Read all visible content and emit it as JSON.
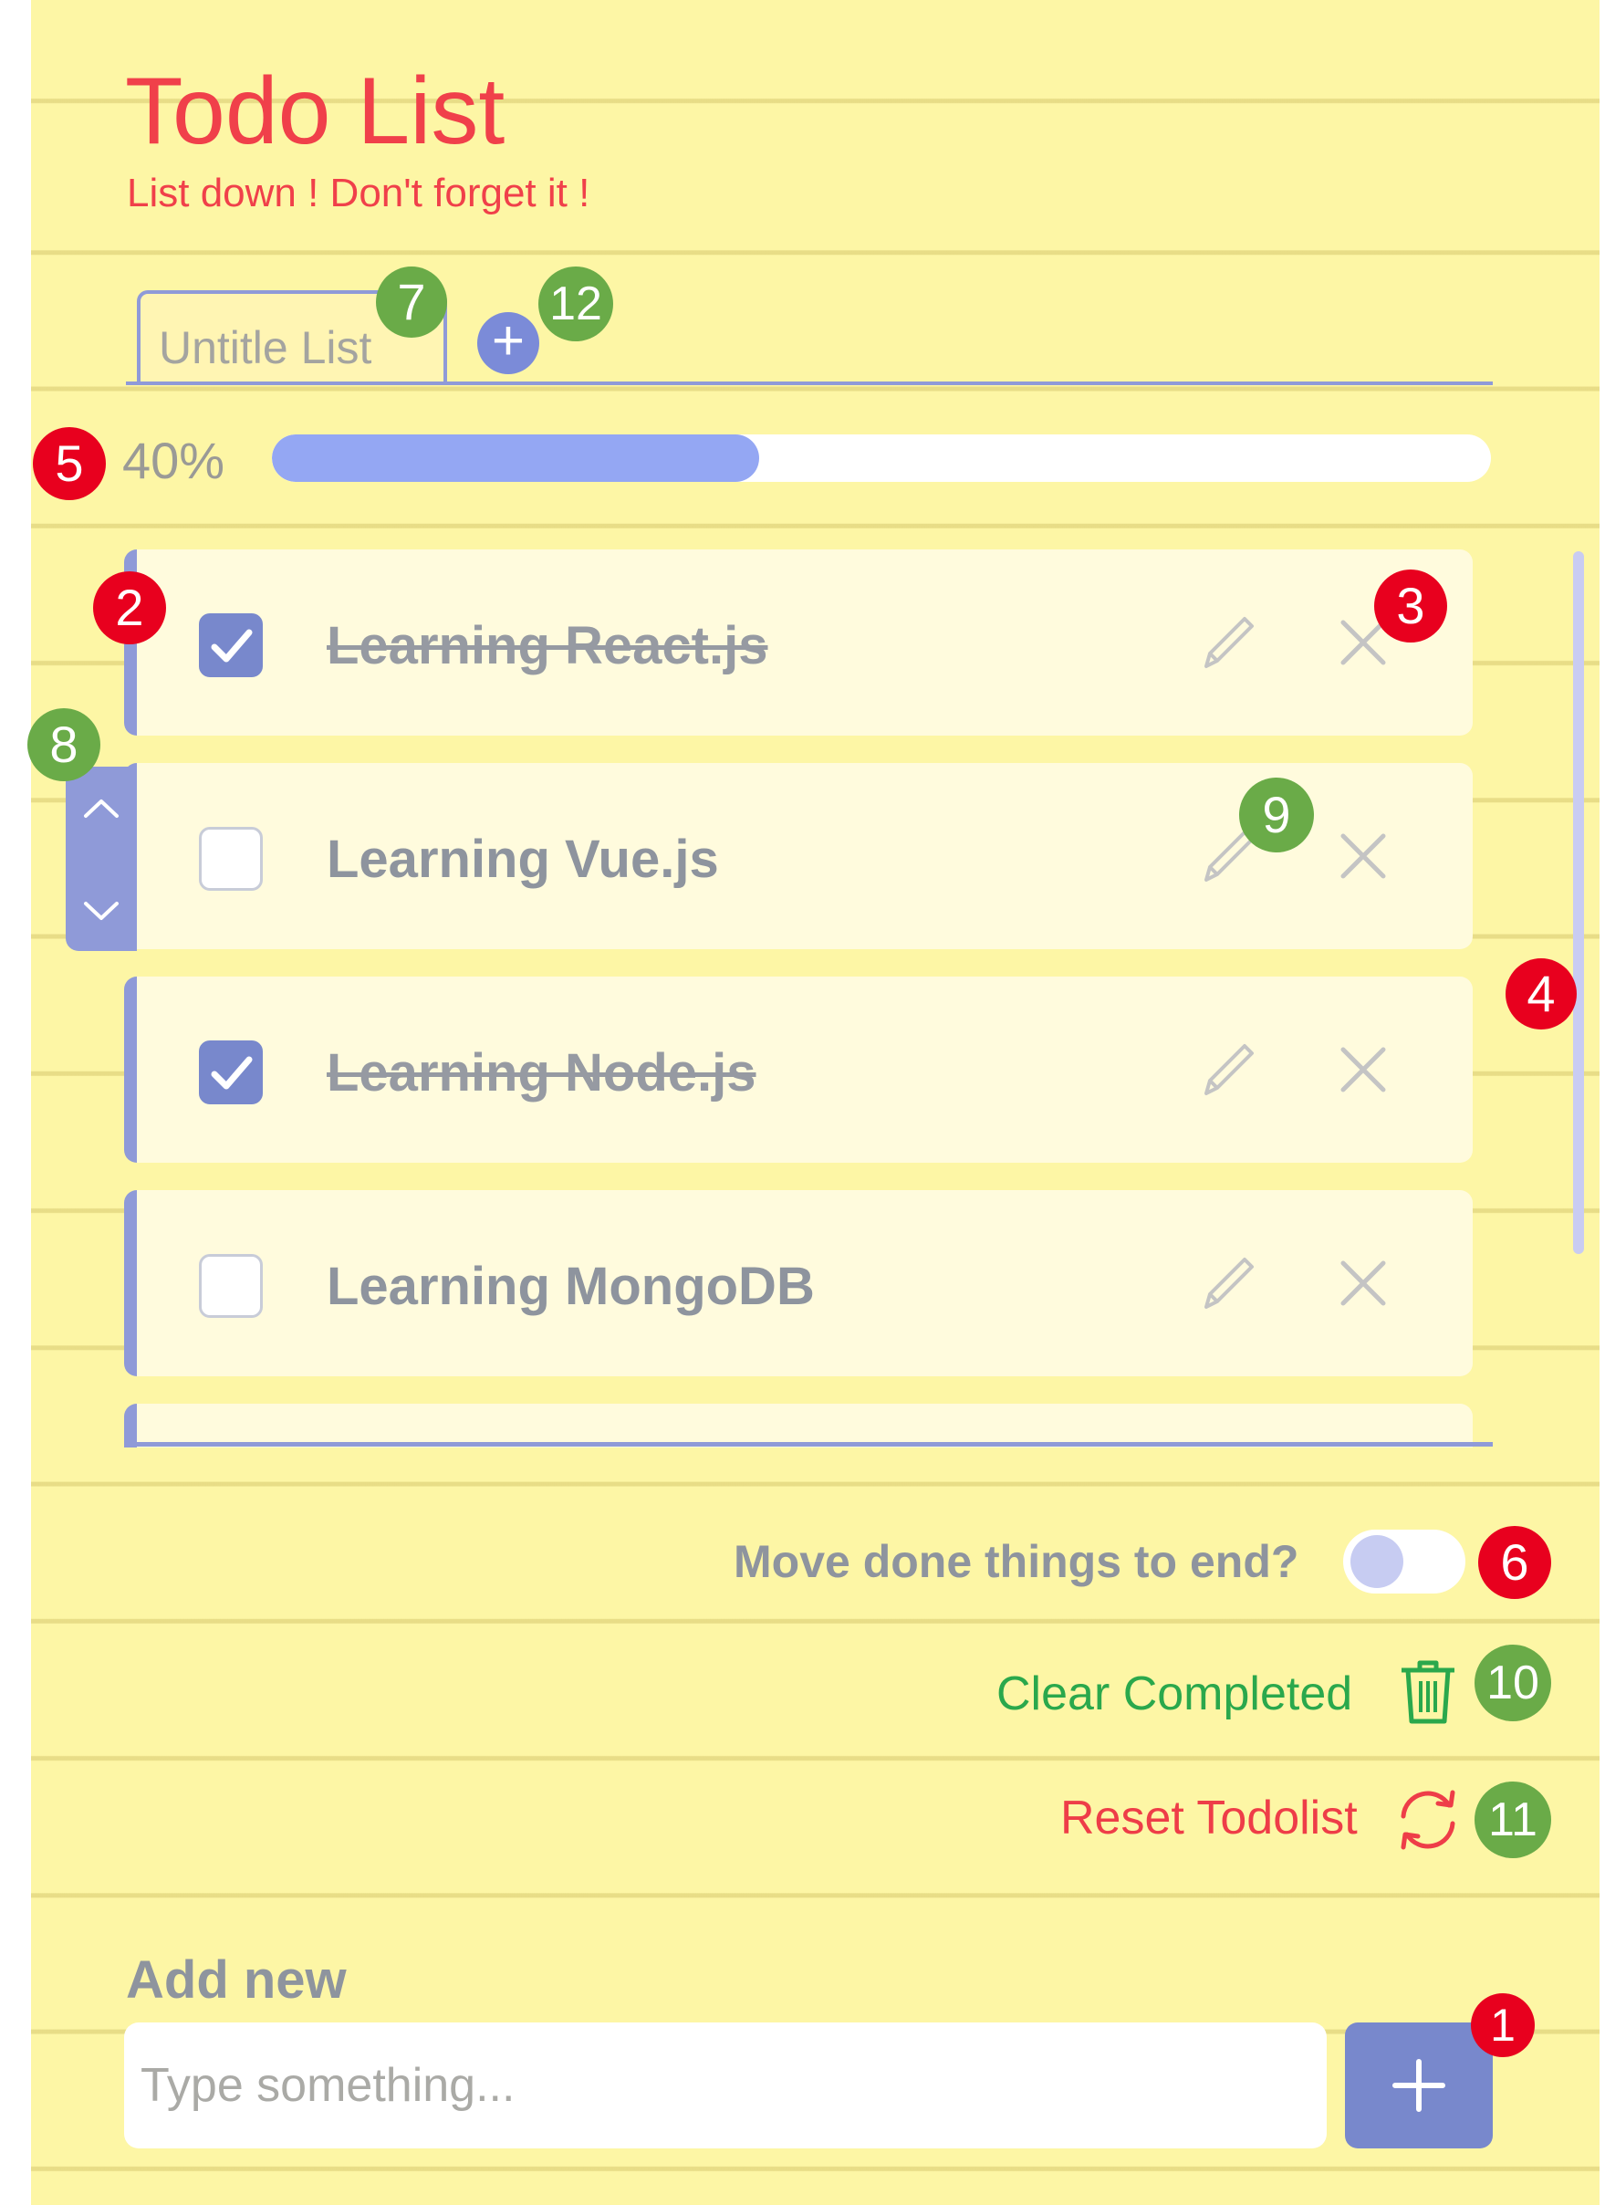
{
  "header": {
    "title": "Todo List",
    "subtitle": "List down ! Don't forget it !"
  },
  "tabs": [
    {
      "label": "Untitle List",
      "active": true
    }
  ],
  "add_tab_icon": "plus-circle-icon",
  "progress": {
    "label": "40%",
    "value": 0.4
  },
  "todos": [
    {
      "text": "Learning React.js",
      "done": true
    },
    {
      "text": "Learning Vue.js",
      "done": false
    },
    {
      "text": "Learning Node.js",
      "done": true
    },
    {
      "text": "Learning MongoDB",
      "done": false
    }
  ],
  "item_icons": {
    "edit": "pencil-icon",
    "delete": "close-icon",
    "move_up": "chevron-up-icon",
    "move_down": "chevron-down-icon"
  },
  "options": {
    "move_done_label": "Move done things to end?",
    "move_done_enabled": false,
    "clear_completed_label": "Clear Completed",
    "clear_completed_icon": "trash-icon",
    "reset_label": "Reset Todolist",
    "reset_icon": "refresh-icon"
  },
  "add_new": {
    "label": "Add new",
    "placeholder": "Type something...",
    "value": "",
    "button_icon": "plus-icon"
  },
  "badges": [
    "1",
    "2",
    "3",
    "4",
    "5",
    "6",
    "7",
    "8",
    "9",
    "10",
    "11",
    "12"
  ],
  "colors": {
    "paper": "#fdf6a5",
    "accent": "#8f9ad8",
    "title_red": "#f0404a",
    "clear_green": "#2aa84c",
    "badge_red": "#e8001e",
    "badge_green": "#6aab48"
  }
}
